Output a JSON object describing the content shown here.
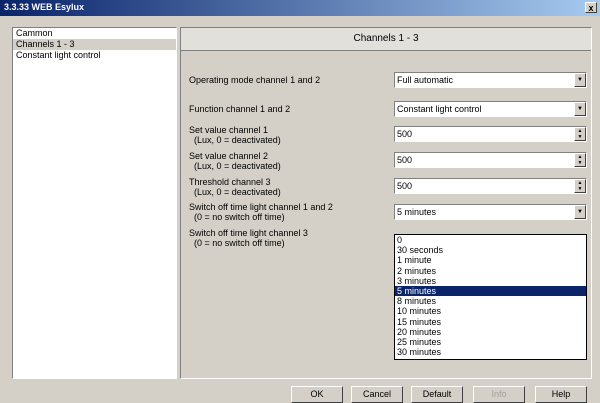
{
  "window": {
    "title": "3.3.33 WEB Esylux",
    "close_glyph": "x"
  },
  "sidebar": {
    "items": [
      {
        "label": "Cammon"
      },
      {
        "label": "Channels 1 - 3"
      },
      {
        "label": "Constant light control"
      }
    ]
  },
  "panel": {
    "title": "Channels 1 - 3",
    "rows": [
      {
        "label": "Operating mode channel 1 and 2",
        "value": "Full automatic",
        "control": "dropdown"
      },
      {
        "label": "Function channel 1 and 2",
        "value": "Constant light control",
        "control": "dropdown"
      },
      {
        "label": "Set value channel 1\n  (Lux, 0 = deactivated)",
        "value": "500",
        "control": "spinner"
      },
      {
        "label": "Set value channel 2\n  (Lux, 0 = deactivated)",
        "value": "500",
        "control": "spinner"
      },
      {
        "label": "Threshold channel 3\n  (Lux, 0 = deactivated)",
        "value": "500",
        "control": "spinner"
      },
      {
        "label": "Switch off time light channel 1 and 2\n  (0 = no switch off time)",
        "value": "5 minutes",
        "control": "dropdown"
      },
      {
        "label": "Switch off time light channel 3\n  (0 = no switch off time)",
        "value": "",
        "control": "dropdown"
      }
    ],
    "dropdown_options": [
      "0",
      "30 seconds",
      "1 minute",
      "2 minutes",
      "3 minutes",
      "5 minutes",
      "8 minutes",
      "10 minutes",
      "15 minutes",
      "20 minutes",
      "25 minutes",
      "30 minutes"
    ],
    "dropdown_selected": "5 minutes"
  },
  "buttons": {
    "ok": "OK",
    "cancel": "Cancel",
    "default": "Default",
    "info": "Info",
    "help": "Help"
  }
}
